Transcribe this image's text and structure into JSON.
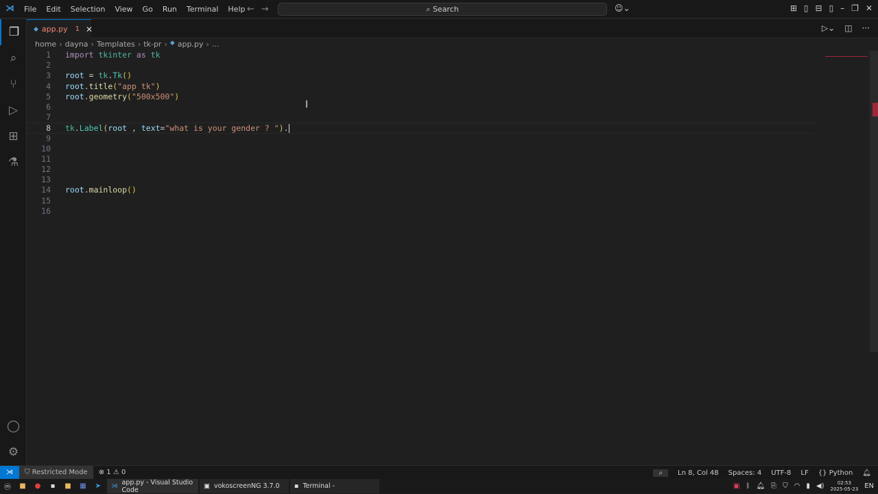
{
  "menu": [
    "File",
    "Edit",
    "Selection",
    "View",
    "Go",
    "Run",
    "Terminal",
    "Help"
  ],
  "search": {
    "label": "Search"
  },
  "tab": {
    "name": "app.py",
    "problems": "1"
  },
  "breadcrumb": [
    "home",
    "dayna",
    "Templates",
    "tk-pr",
    "app.py",
    "..."
  ],
  "code": [
    [
      [
        "kw",
        "import"
      ],
      [
        "op",
        " "
      ],
      [
        "mod",
        "tkinter"
      ],
      [
        "op",
        " "
      ],
      [
        "kw",
        "as"
      ],
      [
        "op",
        " "
      ],
      [
        "mod",
        "tk"
      ]
    ],
    [],
    [
      [
        "id",
        "root"
      ],
      [
        "op",
        " = "
      ],
      [
        "mod",
        "tk"
      ],
      [
        "op",
        "."
      ],
      [
        "cls",
        "Tk"
      ],
      [
        "p",
        "()"
      ]
    ],
    [
      [
        "id",
        "root"
      ],
      [
        "op",
        "."
      ],
      [
        "fn",
        "title"
      ],
      [
        "p",
        "("
      ],
      [
        "str",
        "\"app tk\""
      ],
      [
        "p",
        ")"
      ]
    ],
    [
      [
        "id",
        "root"
      ],
      [
        "op",
        "."
      ],
      [
        "fn",
        "geometry"
      ],
      [
        "p",
        "("
      ],
      [
        "str",
        "\"500x500\""
      ],
      [
        "p",
        ")"
      ]
    ],
    [],
    [],
    [
      [
        "mod",
        "tk"
      ],
      [
        "op",
        "."
      ],
      [
        "cls",
        "Label"
      ],
      [
        "p",
        "("
      ],
      [
        "id",
        "root"
      ],
      [
        "op",
        " , "
      ],
      [
        "id",
        "text"
      ],
      [
        "op",
        "="
      ],
      [
        "str",
        "\"what is your gender ? \""
      ],
      [
        "p",
        ")"
      ],
      [
        "op",
        "."
      ]
    ],
    [],
    [],
    [],
    [],
    [],
    [
      [
        "id",
        "root"
      ],
      [
        "op",
        "."
      ],
      [
        "fn",
        "mainloop"
      ],
      [
        "p",
        "()"
      ]
    ],
    [],
    []
  ],
  "current_line": 8,
  "status": {
    "restricted": "Restricted Mode",
    "errors": "1",
    "warnings": "0",
    "position": "Ln 8, Col 48",
    "spaces": "Spaces: 4",
    "encoding": "UTF-8",
    "eol": "LF",
    "language": "Python"
  },
  "taskbar": {
    "tasks": [
      "app.py - Visual Studio Code",
      "vokoscreenNG 3.7.0",
      "Terminal -"
    ],
    "time": "02:53",
    "date": "2025-05-23",
    "lang": "EN"
  }
}
